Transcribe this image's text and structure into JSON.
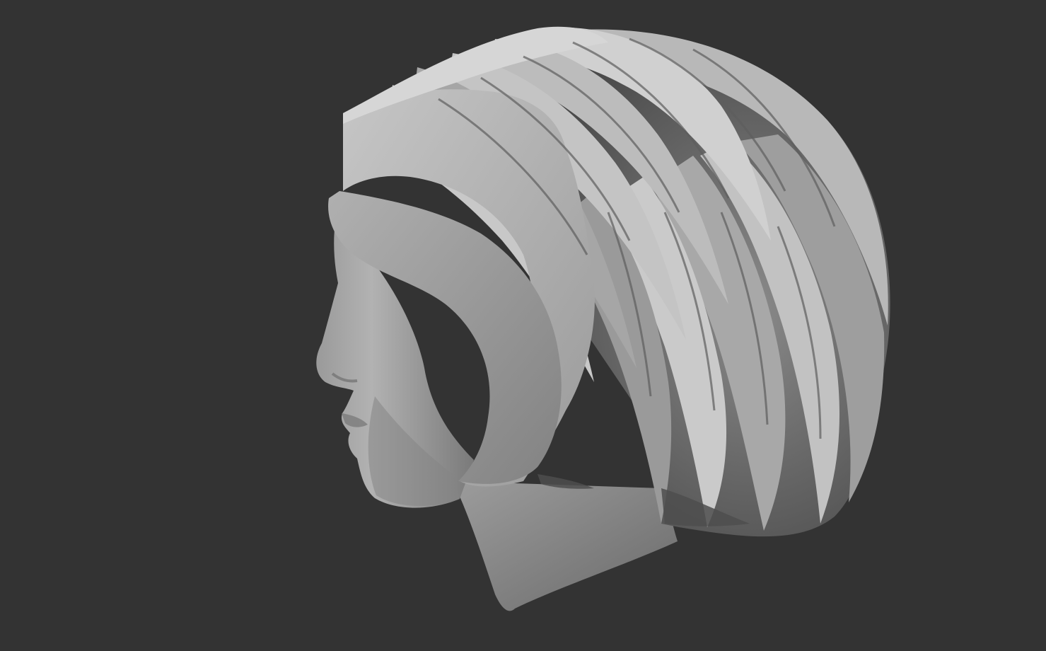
{
  "scene": {
    "subject": "sculpted-head-profile-with-bob-hairstyle",
    "view": "left-side-profile",
    "colors": {
      "background": "#333333",
      "skin_light": "#b4b4b4",
      "skin_mid": "#8e8e8e",
      "skin_dark": "#5a5a5a",
      "hair_light": "#c8c8c8",
      "hair_mid": "#a4a4a4",
      "hair_shadow": "#6a6a6a",
      "hair_deep_shadow": "#3a3a3a"
    }
  }
}
